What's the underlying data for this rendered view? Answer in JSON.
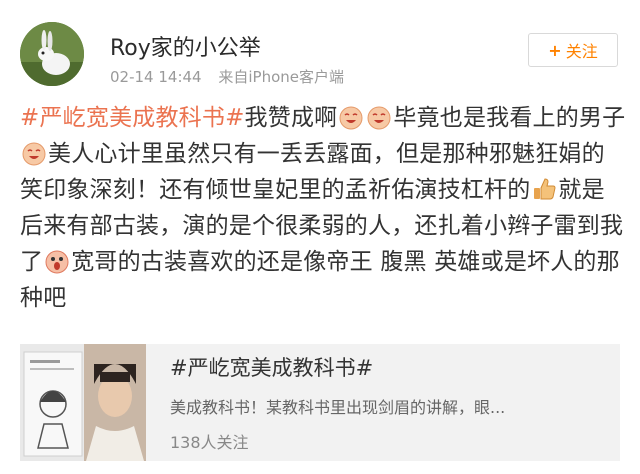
{
  "user": {
    "name": "Roy家的小公举",
    "time": "02-14 14:44",
    "source": "来自iPhone客户端"
  },
  "follow": {
    "plus": "+",
    "label": "关注"
  },
  "post": {
    "topic": "#严屹宽美成教科书#",
    "seg1": "我赞成啊",
    "seg2": "毕竟也是我看上的男子",
    "seg3": "美人心计里虽然只有一丢丢露面，但是那种邪魅狂娟的笑印象深刻！还有倾世皇妃里的孟祈佑演技杠杆的",
    "seg4": "就是后来有部古装，演的是个很柔弱的人，还扎着小辫子雷到我了",
    "seg5": "宽哥的古装喜欢的还是像帝王 腹黑 英雄或是坏人的那种吧",
    "emojis": [
      "laughing-face-icon",
      "laughing-face-icon",
      "laughing-face-icon",
      "thumbs-up-icon",
      "shocked-face-icon"
    ]
  },
  "card": {
    "title": "#严屹宽美成教科书#",
    "desc": "美成教科书！某教科书里出现剑眉的讲解，眼...",
    "count": "138人关注"
  },
  "colors": {
    "topic": "#eb7350",
    "follow": "#ff8200",
    "meta": "#9a9a9a",
    "card_bg": "#f2f2f2"
  }
}
